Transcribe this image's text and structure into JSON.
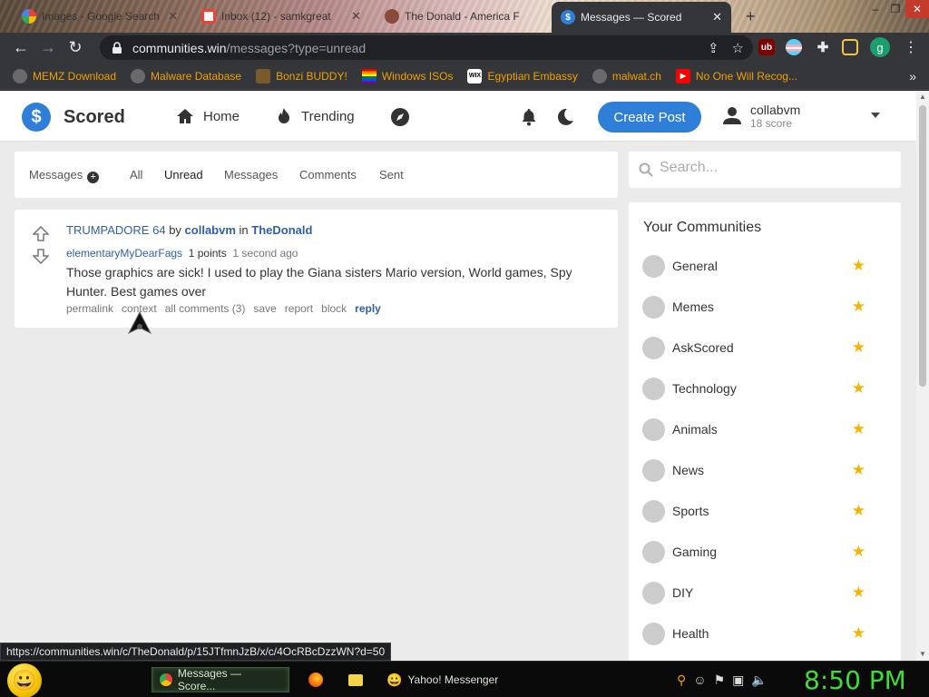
{
  "browser": {
    "tabs": [
      {
        "label": "Images - Google Search",
        "icon": "google-icon"
      },
      {
        "label": "Inbox (12) - samkgreat",
        "icon": "gmail-icon"
      },
      {
        "label": "The Donald - America F",
        "icon": "site-icon"
      },
      {
        "label": "Messages — Scored",
        "icon": "scored-icon"
      }
    ],
    "url_host": "communities.win",
    "url_path": "/messages?type=unread",
    "bookmarks": [
      {
        "label": "MEMZ Download",
        "icon": "globe-icon"
      },
      {
        "label": "Malware Database",
        "icon": "globe-icon"
      },
      {
        "label": "Bonzi BUDDY!",
        "icon": "bonzi-icon"
      },
      {
        "label": "Windows ISOs",
        "icon": "rainbow-flag-icon"
      },
      {
        "label": "Egyptian Embassy",
        "icon": "wix-icon"
      },
      {
        "label": "malwat.ch",
        "icon": "globe-icon"
      },
      {
        "label": "No One Will Recog...",
        "icon": "youtube-icon"
      }
    ],
    "bookmarks_more": "»",
    "profile_initial": "g",
    "status_url": "https://communities.win/c/TheDonald/p/15JTfmnJzB/x/c/4OcRBcDzzWN?d=50"
  },
  "site": {
    "brand": "Scored",
    "logo_glyph": "$",
    "nav": {
      "home": "Home",
      "trending": "Trending"
    },
    "create_post": "Create Post",
    "user": {
      "name": "collabvm",
      "score": "18 score"
    }
  },
  "messages": {
    "header_label": "Messages",
    "filters": [
      "All",
      "Unread",
      "Messages",
      "Comments",
      "Sent"
    ],
    "active_filter": "Unread",
    "item": {
      "post_title": "TRUMPADORE 64",
      "by_word": "by",
      "post_author": "collabvm",
      "in_word": "in",
      "community": "TheDonald",
      "author": "elementaryMyDearFags",
      "points": "1 points",
      "time": "1 second ago",
      "body": "Those graphics are sick! I used to play the Giana sisters Mario version, World games, Spy Hunter. Best games over",
      "actions": [
        "permalink",
        "context",
        "all comments (3)",
        "save",
        "report",
        "block",
        "reply"
      ]
    }
  },
  "sidebar": {
    "search_placeholder": "Search...",
    "communities_title": "Your Communities",
    "communities": [
      "General",
      "Memes",
      "AskScored",
      "Technology",
      "Animals",
      "News",
      "Sports",
      "Gaming",
      "DIY",
      "Health"
    ]
  },
  "taskbar": {
    "tasks": [
      {
        "label": "Messages — Score...",
        "icon": "chrome-icon"
      },
      {
        "label": "",
        "icon": "firefox-icon"
      },
      {
        "label": "",
        "icon": "folder-icon"
      },
      {
        "label": "Yahoo! Messenger",
        "icon": "yahoo-messenger-icon"
      }
    ],
    "clock": "8:50 PM"
  },
  "colors": {
    "accent": "#2f7fd8",
    "link": "#2f5fa8",
    "star": "#f5b400",
    "clock": "#3ddc3a"
  }
}
